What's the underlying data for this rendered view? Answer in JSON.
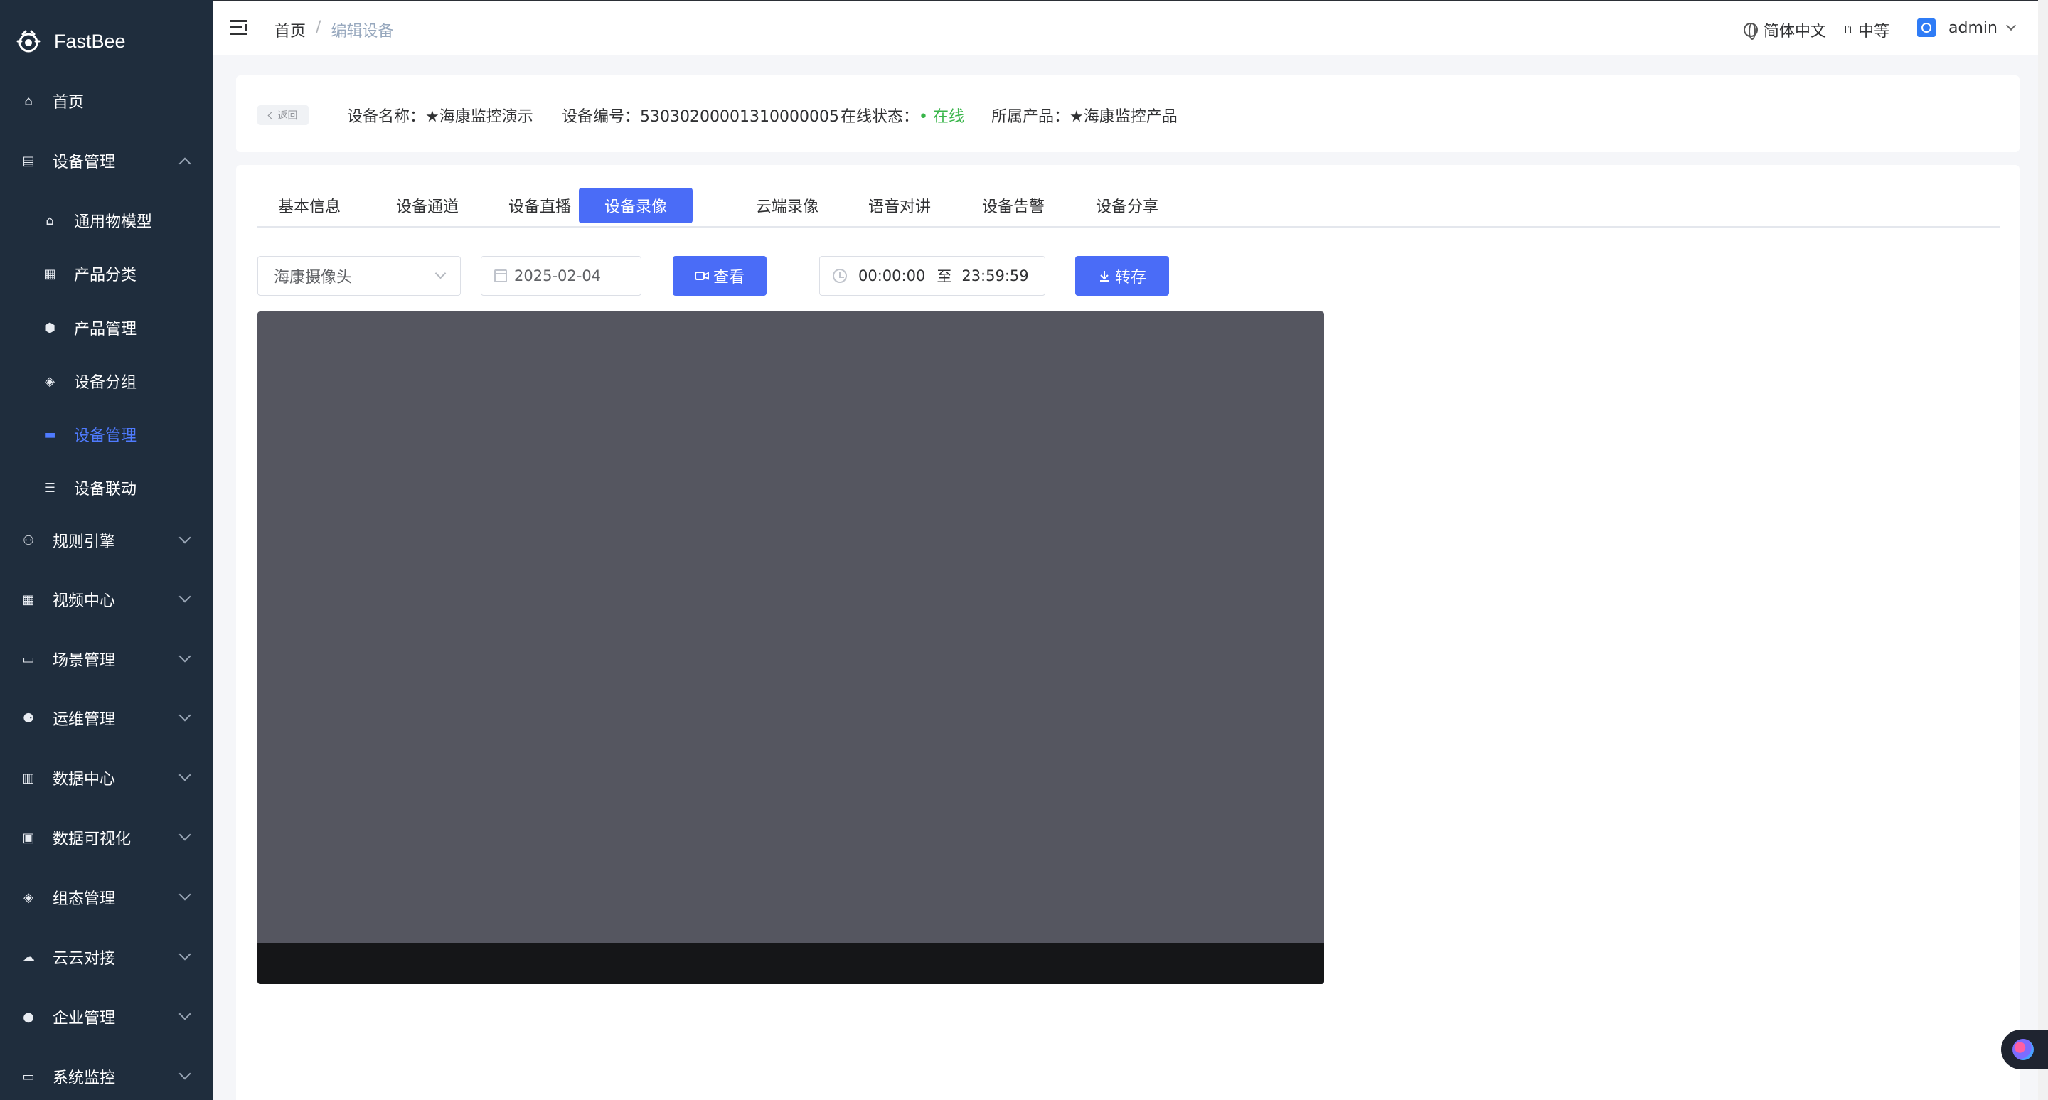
{
  "app": {
    "name": "FastBee"
  },
  "sidebar": {
    "items": [
      {
        "label": "首页",
        "icon": "home-icon",
        "glyph": "⌂",
        "level": 1,
        "expanded": false,
        "active": false,
        "has_children": false
      },
      {
        "label": "设备管理",
        "icon": "device-manage-icon",
        "glyph": "▤",
        "level": 1,
        "expanded": true,
        "active": false,
        "has_children": true
      },
      {
        "label": "通用物模型",
        "icon": "model-icon",
        "glyph": "⌂",
        "level": 2,
        "active": false
      },
      {
        "label": "产品分类",
        "icon": "category-icon",
        "glyph": "▦",
        "level": 2,
        "active": false
      },
      {
        "label": "产品管理",
        "icon": "product-icon",
        "glyph": "⬢",
        "level": 2,
        "active": false
      },
      {
        "label": "设备分组",
        "icon": "group-icon",
        "glyph": "◈",
        "level": 2,
        "active": false
      },
      {
        "label": "设备管理",
        "icon": "device-icon",
        "glyph": "▬",
        "level": 2,
        "active": true
      },
      {
        "label": "设备联动",
        "icon": "linkage-icon",
        "glyph": "☰",
        "level": 2,
        "active": false
      },
      {
        "label": "规则引擎",
        "icon": "rule-engine-icon",
        "glyph": "⚇",
        "level": 1,
        "expanded": false,
        "has_children": true
      },
      {
        "label": "视频中心",
        "icon": "video-center-icon",
        "glyph": "▦",
        "level": 1,
        "expanded": false,
        "has_children": true
      },
      {
        "label": "场景管理",
        "icon": "scene-icon",
        "glyph": "▭",
        "level": 1,
        "expanded": false,
        "has_children": true
      },
      {
        "label": "运维管理",
        "icon": "ops-icon",
        "glyph": "⚈",
        "level": 1,
        "expanded": false,
        "has_children": true
      },
      {
        "label": "数据中心",
        "icon": "data-center-icon",
        "glyph": "▥",
        "level": 1,
        "expanded": false,
        "has_children": true
      },
      {
        "label": "数据可视化",
        "icon": "visualization-icon",
        "glyph": "▣",
        "level": 1,
        "expanded": false,
        "has_children": true
      },
      {
        "label": "组态管理",
        "icon": "scada-icon",
        "glyph": "◈",
        "level": 1,
        "expanded": false,
        "has_children": true
      },
      {
        "label": "云云对接",
        "icon": "cloud-icon",
        "glyph": "☁",
        "level": 1,
        "expanded": false,
        "has_children": true
      },
      {
        "label": "企业管理",
        "icon": "enterprise-icon",
        "glyph": "●",
        "level": 1,
        "expanded": false,
        "has_children": true
      },
      {
        "label": "系统监控",
        "icon": "monitor-icon",
        "glyph": "▭",
        "level": 1,
        "expanded": false,
        "has_children": true
      }
    ]
  },
  "header": {
    "breadcrumb": {
      "home": "首页",
      "separator": "/",
      "current": "编辑设备"
    },
    "language": "简体中文",
    "size_icon": "Tt",
    "size": "中等",
    "user": "admin"
  },
  "device_info": {
    "back_label": "返回",
    "name": "设备名称：★海康监控演示",
    "serial": "设备编号：53030200001310000005",
    "status_label": "在线状态：",
    "status_value": "• 在线",
    "product": "所属产品：★海康监控产品",
    "status_color": "#39b54a"
  },
  "tabs": [
    {
      "label": "基本信息",
      "active": false
    },
    {
      "label": "设备通道",
      "active": false
    },
    {
      "label": "设备直播",
      "active": false
    },
    {
      "label": "设备录像",
      "active": true
    },
    {
      "label": "云端录像",
      "active": false
    },
    {
      "label": "语音对讲",
      "active": false
    },
    {
      "label": "设备告警",
      "active": false
    },
    {
      "label": "设备分享",
      "active": false
    }
  ],
  "record": {
    "channel_select": "海康摄像头",
    "date": "2025-02-04",
    "view_button": "查看",
    "time_start": "00:00:00",
    "time_to": "至",
    "time_end": "23:59:59",
    "save_button": "转存"
  },
  "colors": {
    "primary": "#4a6cf7",
    "sidebar_bg": "#1f2d3d",
    "active_menu": "#4f7bff"
  }
}
